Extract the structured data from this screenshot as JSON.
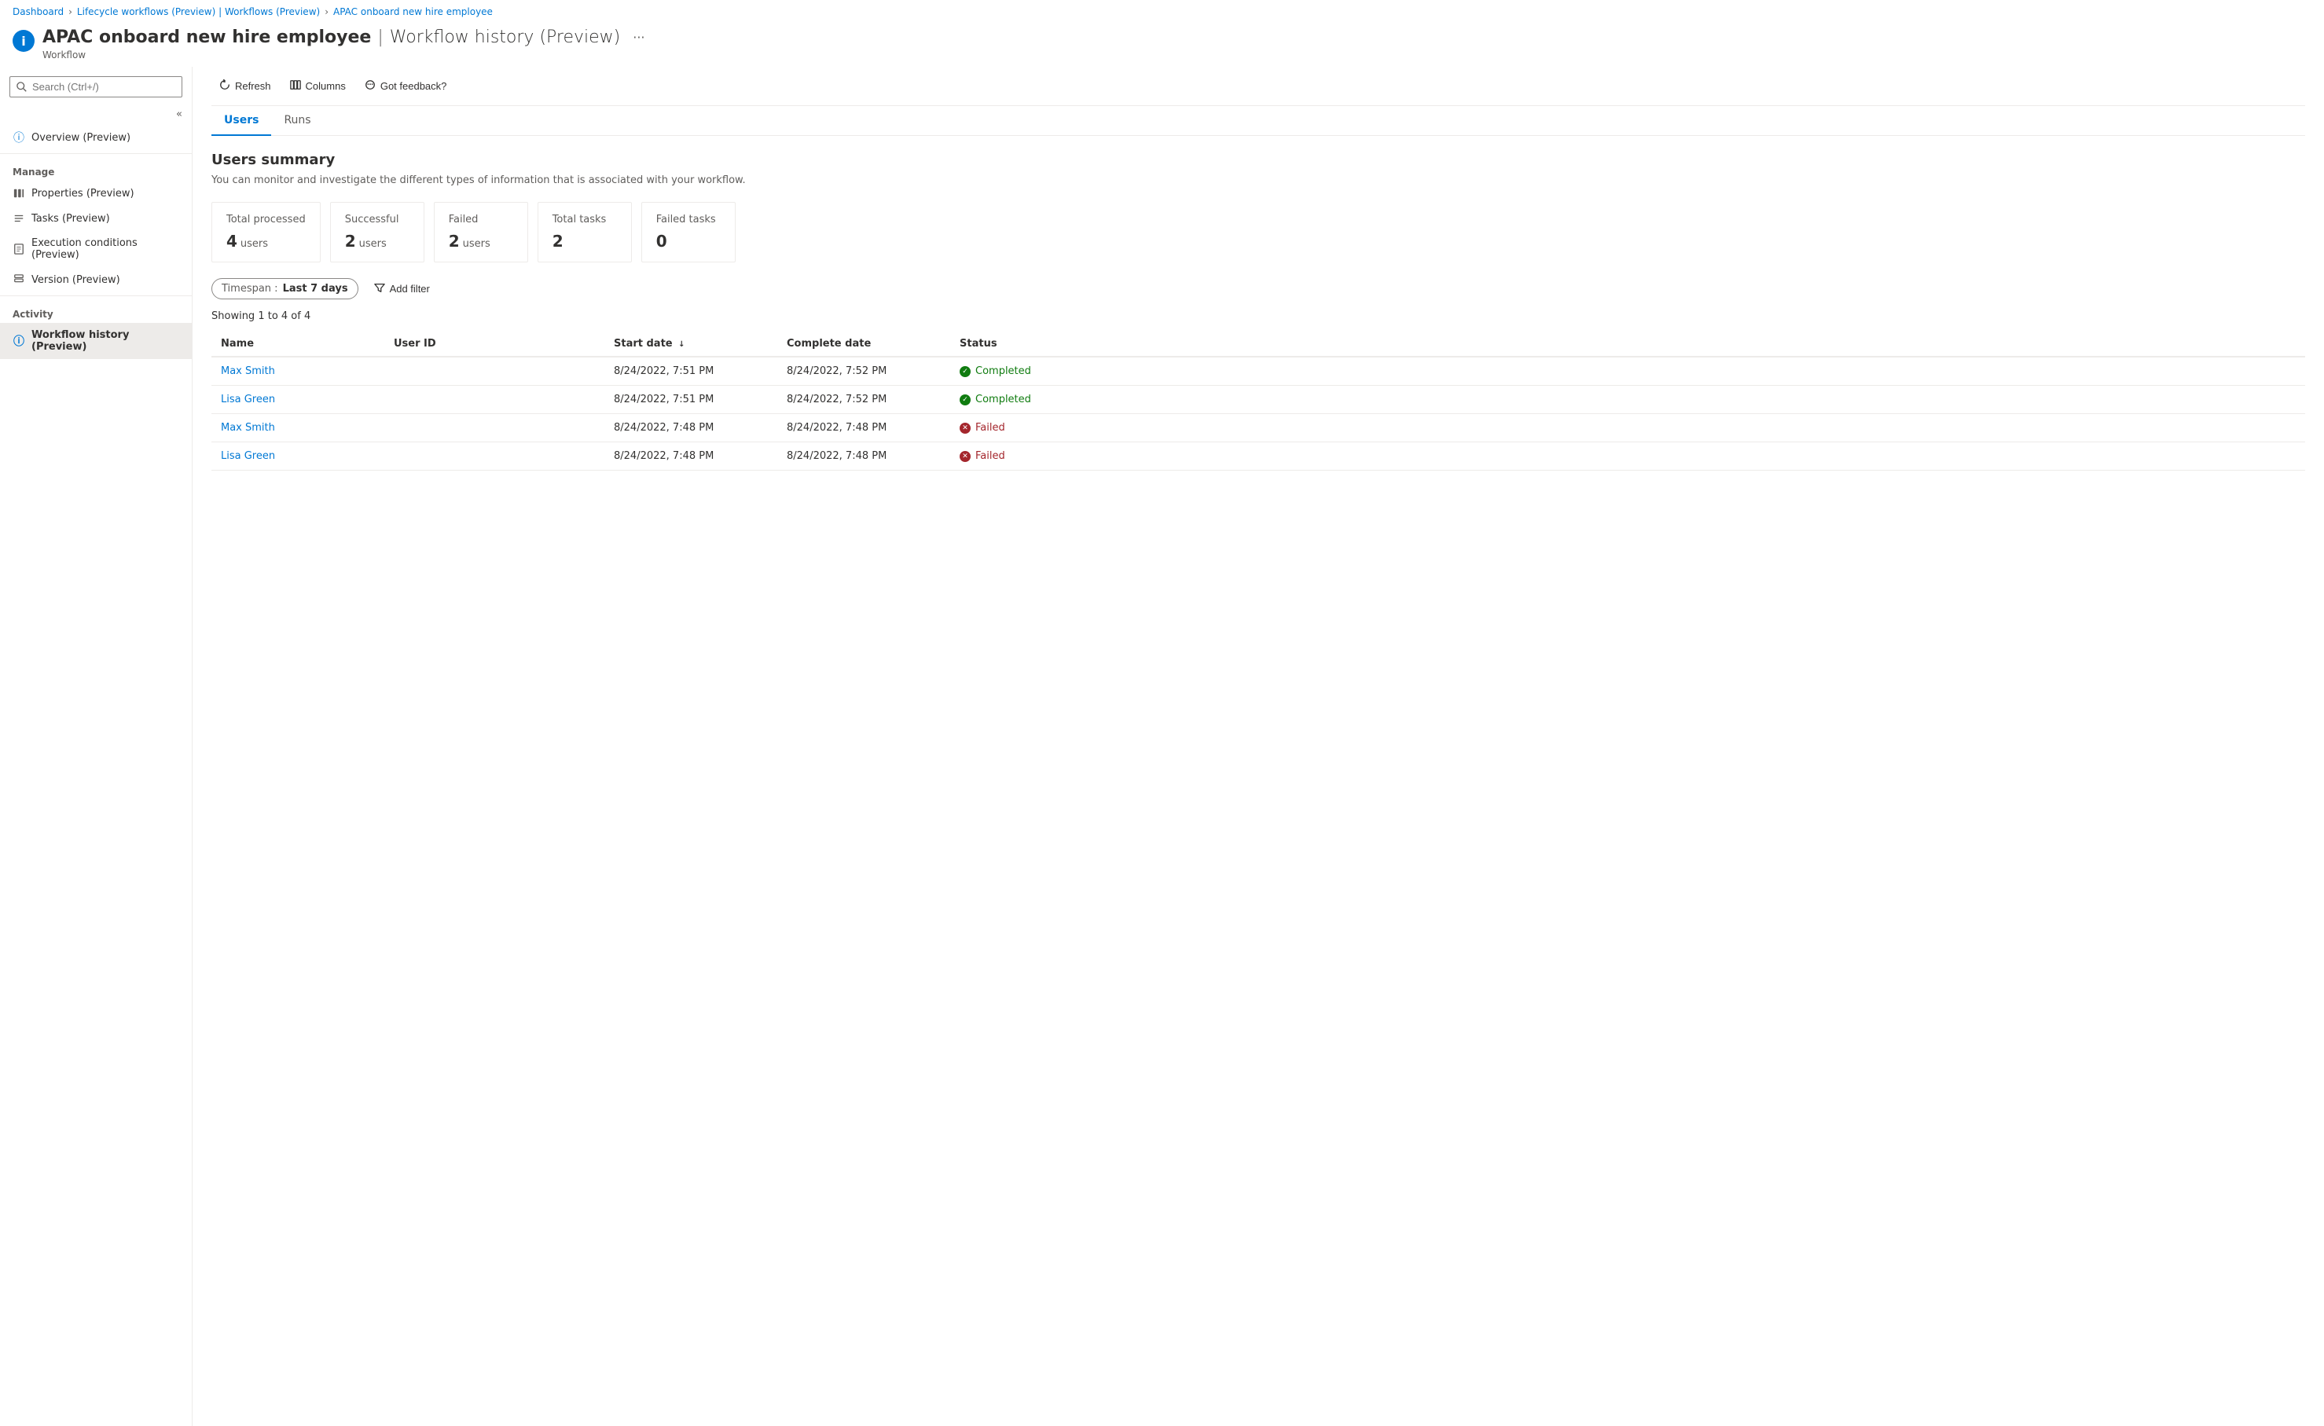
{
  "breadcrumb": {
    "items": [
      {
        "label": "Dashboard",
        "link": true
      },
      {
        "label": "Lifecycle workflows (Preview) | Workflows (Preview)",
        "link": true
      },
      {
        "label": "APAC onboard new hire employee",
        "link": true
      }
    ],
    "separator": ">"
  },
  "pageHeader": {
    "icon": "i",
    "title": "APAC onboard new hire employee",
    "titleSeparator": "|",
    "titleSuffix": "Workflow history (Preview)",
    "subtitle": "Workflow",
    "ellipsis": "···"
  },
  "toolbar": {
    "refresh_label": "Refresh",
    "columns_label": "Columns",
    "feedback_label": "Got feedback?"
  },
  "sidebar": {
    "search_placeholder": "Search (Ctrl+/)",
    "collapse_title": "Collapse",
    "overview_label": "Overview (Preview)",
    "manage_section": "Manage",
    "manage_items": [
      {
        "label": "Properties (Preview)",
        "icon": "bars"
      },
      {
        "label": "Tasks (Preview)",
        "icon": "list"
      },
      {
        "label": "Execution conditions (Preview)",
        "icon": "doc"
      },
      {
        "label": "Version (Preview)",
        "icon": "stack"
      }
    ],
    "activity_section": "Activity",
    "activity_items": [
      {
        "label": "Workflow history (Preview)",
        "icon": "info",
        "active": true
      }
    ]
  },
  "tabs": [
    {
      "label": "Users",
      "active": true
    },
    {
      "label": "Runs",
      "active": false
    }
  ],
  "usersSummary": {
    "title": "Users summary",
    "description": "You can monitor and investigate the different types of information that is associated with your workflow.",
    "cards": [
      {
        "label": "Total processed",
        "value": "4",
        "unit": "users"
      },
      {
        "label": "Successful",
        "value": "2",
        "unit": "users"
      },
      {
        "label": "Failed",
        "value": "2",
        "unit": "users"
      },
      {
        "label": "Total tasks",
        "value": "2",
        "unit": ""
      },
      {
        "label": "Failed tasks",
        "value": "0",
        "unit": ""
      }
    ]
  },
  "filterBar": {
    "chip_key": "Timespan :",
    "chip_value": "Last 7 days",
    "add_filter_label": "Add filter"
  },
  "showingLabel": "Showing 1 to 4 of 4",
  "table": {
    "columns": [
      {
        "key": "name",
        "label": "Name"
      },
      {
        "key": "userId",
        "label": "User ID"
      },
      {
        "key": "startDate",
        "label": "Start date",
        "sortable": true,
        "sortDir": "↓"
      },
      {
        "key": "completeDate",
        "label": "Complete date"
      },
      {
        "key": "status",
        "label": "Status"
      }
    ],
    "rows": [
      {
        "name": "Max Smith",
        "userId": "",
        "startDate": "8/24/2022, 7:51 PM",
        "completeDate": "8/24/2022, 7:52 PM",
        "status": "Completed",
        "statusType": "completed"
      },
      {
        "name": "Lisa Green",
        "userId": "",
        "startDate": "8/24/2022, 7:51 PM",
        "completeDate": "8/24/2022, 7:52 PM",
        "status": "Completed",
        "statusType": "completed"
      },
      {
        "name": "Max Smith",
        "userId": "",
        "startDate": "8/24/2022, 7:48 PM",
        "completeDate": "8/24/2022, 7:48 PM",
        "status": "Failed",
        "statusType": "failed"
      },
      {
        "name": "Lisa Green",
        "userId": "",
        "startDate": "8/24/2022, 7:48 PM",
        "completeDate": "8/24/2022, 7:48 PM",
        "status": "Failed",
        "statusType": "failed"
      }
    ]
  }
}
